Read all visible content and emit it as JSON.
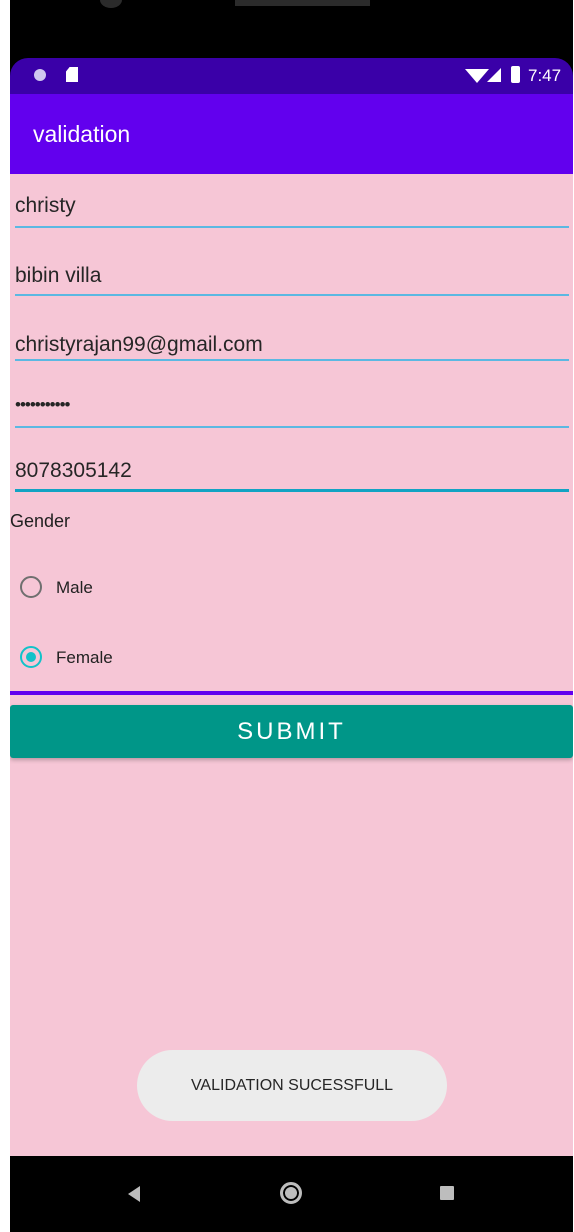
{
  "status_bar": {
    "time": "7:47",
    "icons": [
      "dot-icon",
      "sd-card-icon",
      "wifi-icon",
      "signal-icon",
      "battery-icon"
    ]
  },
  "app_bar": {
    "title": "validation"
  },
  "form": {
    "name": {
      "value": "christy"
    },
    "address": {
      "value": "bibin villa"
    },
    "email": {
      "value": "christyrajan99@gmail.com"
    },
    "password": {
      "value": "•••••••••••"
    },
    "phone": {
      "value": "8078305142"
    },
    "gender_label": "Gender",
    "gender_options": [
      {
        "label": "Male",
        "checked": false
      },
      {
        "label": "Female",
        "checked": true
      }
    ],
    "submit_label": "SUBMIT"
  },
  "toast": {
    "message": "VALIDATION SUCESSFULL"
  },
  "nav_bar": {
    "icons": [
      "back-icon",
      "home-icon",
      "recents-icon"
    ]
  },
  "colors": {
    "status_bar": "#3a00a8",
    "app_bar": "#6200ee",
    "background": "#f6c6d6",
    "accent": "#12c2c9",
    "button": "#009688",
    "divider": "#6200ee"
  }
}
